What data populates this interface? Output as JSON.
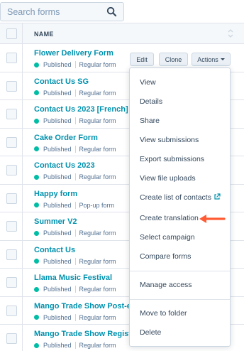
{
  "search": {
    "placeholder": "Search forms",
    "icon": "search-icon"
  },
  "table": {
    "header": {
      "name": "NAME"
    },
    "rows": [
      {
        "name": "Flower Delivery Form",
        "status": "Published",
        "type": "Regular form"
      },
      {
        "name": "Contact Us SG",
        "status": "Published",
        "type": "Regular form"
      },
      {
        "name": "Contact Us 2023 [French]",
        "status": "Published",
        "type": "Regular form"
      },
      {
        "name": "Cake Order Form",
        "status": "Published",
        "type": "Regular form"
      },
      {
        "name": "Contact Us 2023",
        "status": "Published",
        "type": "Regular form"
      },
      {
        "name": "Happy form",
        "status": "Published",
        "type": "Pop-up form"
      },
      {
        "name": "Summer V2",
        "status": "Published",
        "type": "Regular form"
      },
      {
        "name": "Contact Us",
        "status": "Published",
        "type": "Regular form"
      },
      {
        "name": "Llama Music Festival",
        "status": "Published",
        "type": "Regular form"
      },
      {
        "name": "Mango Trade Show Post-eve",
        "status": "Published",
        "type": "Regular form"
      },
      {
        "name": "Mango Trade Show Registra",
        "status": "Published",
        "type": "Regular form"
      }
    ]
  },
  "row_actions": {
    "edit": "Edit",
    "clone": "Clone",
    "actions": "Actions"
  },
  "actions_menu": {
    "items": [
      "View",
      "Details",
      "Share",
      "View submissions",
      "Export submissions",
      "View file uploads",
      "Create list of contacts",
      "Create translation",
      "Select campaign",
      "Compare forms",
      "Manage access",
      "Move to folder",
      "Delete"
    ],
    "highlighted": "Create translation"
  },
  "colors": {
    "link": "#0091ae",
    "published_dot": "#00bda5",
    "arrow": "#ff5c35",
    "header_bg": "#f5f8fa"
  }
}
